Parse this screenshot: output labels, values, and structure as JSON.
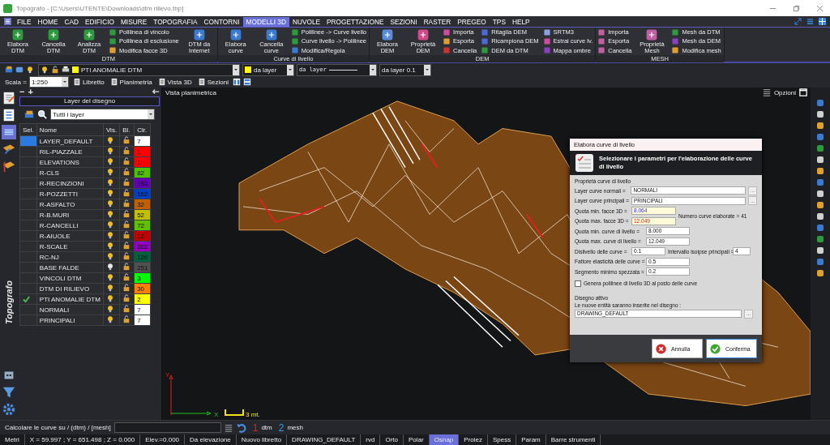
{
  "window": {
    "title": "Topografo - [C:\\Users\\UTENTE\\Downloads\\dtm rilievo.thp]"
  },
  "menu": [
    {
      "label": "FILE",
      "selected": false
    },
    {
      "label": "HOME",
      "selected": false
    },
    {
      "label": "CAD",
      "selected": false
    },
    {
      "label": "EDIFICIO",
      "selected": false
    },
    {
      "label": "MISURE",
      "selected": false
    },
    {
      "label": "TOPOGRAFIA",
      "selected": false
    },
    {
      "label": "CONTORNI",
      "selected": false
    },
    {
      "label": "MODELLI 3D",
      "selected": true
    },
    {
      "label": "NUVOLE",
      "selected": false
    },
    {
      "label": "PROGETTAZIONE",
      "selected": false
    },
    {
      "label": "SEZIONI",
      "selected": false
    },
    {
      "label": "RASTER",
      "selected": false
    },
    {
      "label": "PREGEO",
      "selected": false
    },
    {
      "label": "TPS",
      "selected": false
    },
    {
      "label": "HELP",
      "selected": false
    }
  ],
  "ribbon": [
    {
      "title": "DTM",
      "columns": [
        {
          "kind": "large",
          "items": [
            {
              "label": "Elabora DTM",
              "color": "#2e9a3e"
            }
          ]
        },
        {
          "kind": "large",
          "items": [
            {
              "label": "Cancella DTM",
              "color": "#2e9a3e"
            }
          ]
        },
        {
          "kind": "large",
          "items": [
            {
              "label": "Analizza DTM",
              "color": "#2e9a3e"
            }
          ]
        },
        {
          "kind": "small",
          "items": [
            {
              "label": "Polilinea di vincolo",
              "color": "#2e9a3e"
            },
            {
              "label": "Polilinea di esclusione",
              "color": "#2e9a3e"
            },
            {
              "label": "Modifica facce 3D",
              "color": "#e0a030"
            }
          ]
        },
        {
          "kind": "large",
          "items": [
            {
              "label": "DTM da Internet",
              "color": "#3a7ad0"
            }
          ]
        }
      ]
    },
    {
      "title": "Curve di livello",
      "columns": [
        {
          "kind": "large",
          "items": [
            {
              "label": "Elabora curve",
              "color": "#3a7ad0"
            }
          ]
        },
        {
          "kind": "large",
          "items": [
            {
              "label": "Cancella curve",
              "color": "#3a7ad0"
            }
          ]
        },
        {
          "kind": "small",
          "items": [
            {
              "label": "Polilinee -> Curve livello",
              "color": "#2e9a3e"
            },
            {
              "label": "Curve livello -> Polilinee",
              "color": "#2e9a3e"
            },
            {
              "label": "Modifica/Regola",
              "color": "#3a7ad0"
            }
          ]
        }
      ]
    },
    {
      "title": "DEM",
      "columns": [
        {
          "kind": "large",
          "items": [
            {
              "label": "Elabora DEM",
              "color": "#5a8ad8"
            }
          ]
        },
        {
          "kind": "large",
          "items": [
            {
              "label": "Proprietà DEM",
              "color": "#d04a8a"
            }
          ]
        },
        {
          "kind": "small",
          "items": [
            {
              "label": "Importa",
              "color": "#d04aa0"
            },
            {
              "label": "Esporta",
              "color": "#e0a030"
            },
            {
              "label": "Cancella",
              "color": "#d03030"
            }
          ]
        },
        {
          "kind": "small",
          "items": [
            {
              "label": "Ritaglia DEM",
              "color": "#4a6ad8"
            },
            {
              "label": "Ricampiona DEM",
              "color": "#4a6ad8"
            },
            {
              "label": "DEM da DTM",
              "color": "#2e9a3e"
            }
          ]
        },
        {
          "kind": "small",
          "items": [
            {
              "label": "SRTM3",
              "color": "#8aa0e0"
            },
            {
              "label": "Estrai curve lv.",
              "color": "#d04aa0"
            },
            {
              "label": "Mappa ombre",
              "color": "#8a40c0"
            }
          ]
        }
      ]
    },
    {
      "title": "MESH",
      "columns": [
        {
          "kind": "small",
          "items": [
            {
              "label": "Importa",
              "color": "#c060a0"
            },
            {
              "label": "Esporta",
              "color": "#c060a0"
            },
            {
              "label": "Cancella",
              "color": "#c060a0"
            }
          ]
        },
        {
          "kind": "large",
          "items": [
            {
              "label": "Proprietà Mesh",
              "color": "#c060a0"
            }
          ]
        },
        {
          "kind": "small",
          "items": [
            {
              "label": "Mesh da DTM",
              "color": "#2e9a3e"
            },
            {
              "label": "Mesh da DEM",
              "color": "#8a40c0"
            },
            {
              "label": "Modifica mesh",
              "color": "#e0a030"
            }
          ]
        }
      ]
    }
  ],
  "toolbar": {
    "layer": "PTI ANOMALIE DTM",
    "color_mode": "da layer",
    "linetype": "da layer",
    "lineweight": "da layer 0.1",
    "scale_label": "Scala =",
    "scale": "1:250",
    "views": [
      "Libretto",
      "Planimetria",
      "Vista 3D",
      "Sezioni"
    ]
  },
  "layer_panel": {
    "collapse": "−",
    "expand": "+",
    "title": "Layer del disegno",
    "filter": "Tutti i layer",
    "columns": [
      "Sel.",
      "Nome",
      "Vis.",
      "Bl.",
      "Clr."
    ],
    "rows": [
      {
        "name": "LAYER_DEFAULT",
        "selected": true,
        "current": false,
        "visible": true,
        "color_index": "7",
        "color": "#ffffff"
      },
      {
        "name": "RIL-PIAZZALE",
        "selected": false,
        "current": false,
        "visible": true,
        "color_index": "1",
        "color": "#ff0000"
      },
      {
        "name": "ELEVATIONS",
        "selected": false,
        "current": false,
        "visible": true,
        "color_index": "1",
        "color": "#ff0000"
      },
      {
        "name": "R-CLS",
        "selected": false,
        "current": false,
        "visible": true,
        "color_index": "82",
        "color": "#50c000"
      },
      {
        "name": "R-RECINZIONI",
        "selected": false,
        "current": false,
        "visible": true,
        "color_index": "192",
        "color": "#6000b0"
      },
      {
        "name": "R-POZZETTI",
        "selected": false,
        "current": false,
        "visible": true,
        "color_index": "162",
        "color": "#0040c0"
      },
      {
        "name": "R-ASFALTO",
        "selected": false,
        "current": false,
        "visible": true,
        "color_index": "32",
        "color": "#c06000"
      },
      {
        "name": "R-B.MURI",
        "selected": false,
        "current": false,
        "visible": true,
        "color_index": "52",
        "color": "#c0c000"
      },
      {
        "name": "R-CANCELLI",
        "selected": false,
        "current": false,
        "visible": true,
        "color_index": "72",
        "color": "#60c000"
      },
      {
        "name": "R-AIUOLE",
        "selected": false,
        "current": false,
        "visible": true,
        "color_index": "12",
        "color": "#c00000"
      },
      {
        "name": "R-SCALE",
        "selected": false,
        "current": false,
        "visible": true,
        "color_index": "202",
        "color": "#9000c0"
      },
      {
        "name": "RC-NJ",
        "selected": false,
        "current": false,
        "visible": true,
        "color_index": "126",
        "color": "#006040"
      },
      {
        "name": "BASE FALDE",
        "selected": false,
        "current": false,
        "visible": false,
        "color_index": "251",
        "color": "#505050"
      },
      {
        "name": "VINCOLI DTM",
        "selected": false,
        "current": false,
        "visible": true,
        "color_index": "3",
        "color": "#00ff00"
      },
      {
        "name": "DTM DI RILIEVO",
        "selected": false,
        "current": false,
        "visible": true,
        "color_index": "30",
        "color": "#ff8000"
      },
      {
        "name": "PTI ANOMALIE DTM",
        "selected": false,
        "current": true,
        "visible": true,
        "color_index": "2",
        "color": "#ffff00"
      },
      {
        "name": "NORMALI",
        "selected": false,
        "current": false,
        "visible": true,
        "color_index": "7",
        "color": "#ffffff"
      },
      {
        "name": "PRINCIPALI",
        "selected": false,
        "current": false,
        "visible": true,
        "color_index": "7",
        "color": "#ffffff"
      }
    ]
  },
  "side_label": "Topografo",
  "canvas": {
    "title": "Vista planimetrica",
    "options": "Opzioni",
    "axis_y": "Y",
    "axis_x": "X",
    "scale_bar": "3 mt."
  },
  "dialog": {
    "title": "Elabora curve di livello",
    "header": "Selezionare i parametri per l'elaborazione delle curve di livello",
    "section": "Proprietà curve di livello",
    "fields": [
      {
        "kind": "browse",
        "label": "Layer curve normali =",
        "value": "NORMALI",
        "browse": "..."
      },
      {
        "kind": "browse",
        "label": "Layer curve principali =",
        "value": "PRINCIPALI",
        "browse": "..."
      },
      {
        "kind": "minimum",
        "label": "Quota min. facce 3D =",
        "value": "8.064"
      },
      {
        "kind": "maximum",
        "label": "Quota max. facce 3D =",
        "value": "12.049"
      },
      {
        "kind": "number",
        "label": "Quota min. curve di livello =",
        "value": "8.000"
      },
      {
        "kind": "number",
        "label": "Quota max. curve di livello =",
        "value": "12.049"
      },
      {
        "kind": "pair",
        "label": "Dislivello delle curve =",
        "value": "0.1",
        "label2": "Intervallo isoipse principali =",
        "value2": "4"
      },
      {
        "kind": "number",
        "label": "Fattore elasticità delle curve =",
        "value": "0.5"
      },
      {
        "kind": "number",
        "label": "Segmento minimo spezzata =",
        "value": "0.2"
      }
    ],
    "note": "Numero curve elaborate = 41",
    "checkbox": {
      "label": "Genera polilinee di livello 3D al posto delle curve",
      "checked": false
    },
    "drawing_section": "Disegno attivo",
    "drawing_hint": "Le nuove entità saranno inserite nel disegno :",
    "drawing": "DRAWING_DEFAULT",
    "drawing_browse": "...",
    "buttons": [
      {
        "label": "Annulla",
        "kind": "cancel"
      },
      {
        "label": "Conferma",
        "kind": "ok"
      }
    ]
  },
  "command": {
    "prompt": "Calcolare le curve su / (dtm) / [mesh]",
    "options": [
      {
        "key": "1",
        "label": "dtm",
        "color": "#e02020"
      },
      {
        "key": "2",
        "label": "mesh",
        "color": "#30a0f0"
      }
    ]
  },
  "status_bar": [
    {
      "label": "Metri",
      "on": false
    },
    {
      "label": "X = 59.997 ; Y = 651.498 ; Z = 0.000",
      "on": false
    },
    {
      "label": "Elev.=0.000",
      "on": false
    },
    {
      "label": "Da elevazione",
      "on": false
    },
    {
      "label": "Nuovo libretto",
      "on": false
    },
    {
      "label": "DRAWING_DEFAULT",
      "on": false
    },
    {
      "label": "rvd",
      "on": false
    },
    {
      "label": "Orto",
      "on": false
    },
    {
      "label": "Polar",
      "on": false
    },
    {
      "label": "Osnap",
      "on": true
    },
    {
      "label": "Proiez",
      "on": false
    },
    {
      "label": "Spess",
      "on": false
    },
    {
      "label": "Param",
      "on": false
    },
    {
      "label": "Barre strumenti",
      "on": false
    }
  ]
}
